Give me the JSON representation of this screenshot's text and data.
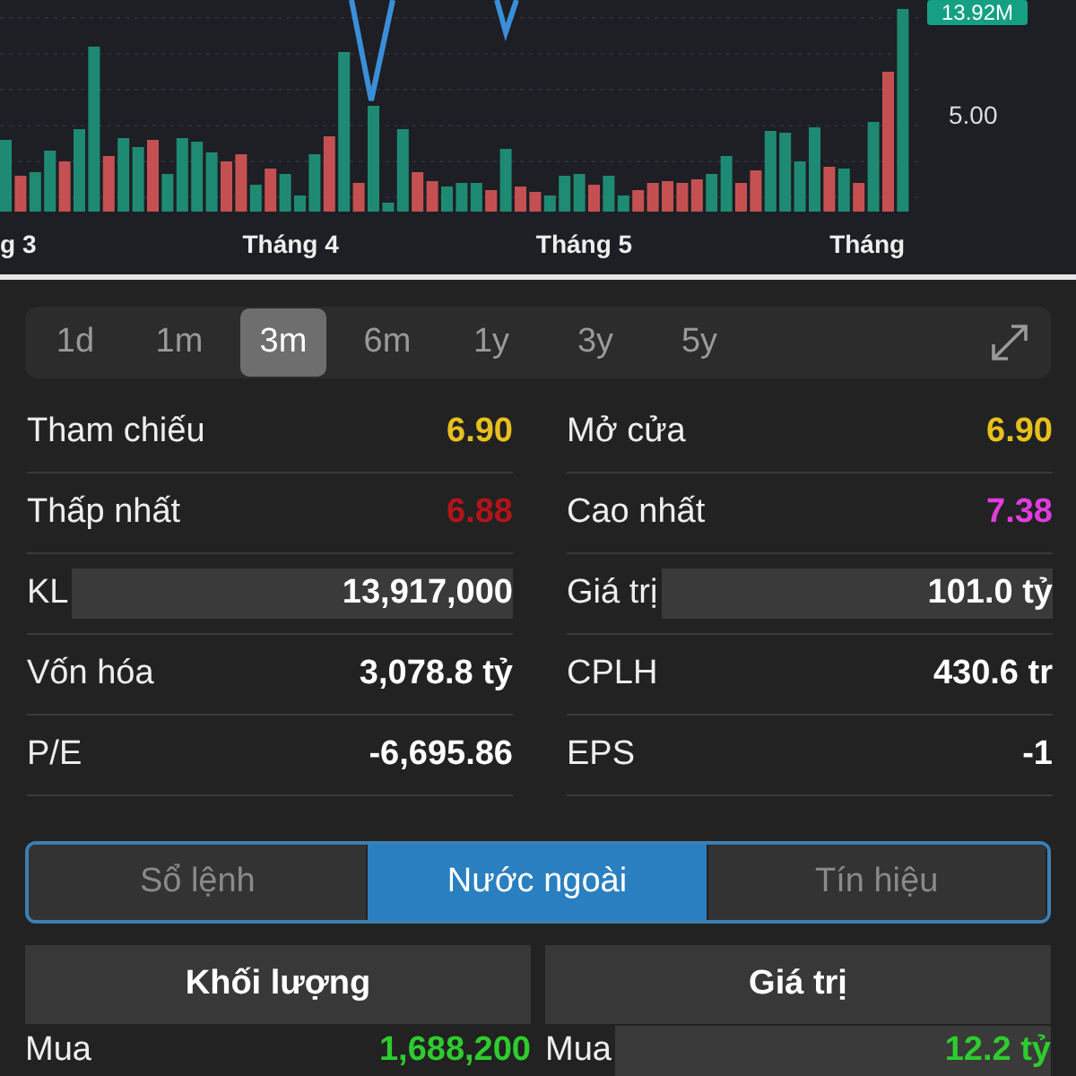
{
  "chart": {
    "price_badge": "13.92M",
    "axis_label": "5.00",
    "x_labels": [
      "g 3",
      "Tháng 4",
      "Tháng 5",
      "Tháng"
    ]
  },
  "periods": [
    {
      "label": "1d",
      "selected": false
    },
    {
      "label": "1m",
      "selected": false
    },
    {
      "label": "3m",
      "selected": true
    },
    {
      "label": "6m",
      "selected": false
    },
    {
      "label": "1y",
      "selected": false
    },
    {
      "label": "3y",
      "selected": false
    },
    {
      "label": "5y",
      "selected": false
    }
  ],
  "stats": [
    {
      "label": "Tham chiếu",
      "value": "6.90",
      "color": "#e8c01e",
      "highlighted": false
    },
    {
      "label": "Mở cửa",
      "value": "6.90",
      "color": "#e8c01e",
      "highlighted": false
    },
    {
      "label": "Thấp nhất",
      "value": "6.88",
      "color": "#b3141a",
      "highlighted": false
    },
    {
      "label": "Cao nhất",
      "value": "7.38",
      "color": "#e03ce0",
      "highlighted": false
    },
    {
      "label": "KL",
      "value": "13,917,000",
      "color": "#ffffff",
      "highlighted": true
    },
    {
      "label": "Giá trị",
      "value": "101.0 tỷ",
      "color": "#ffffff",
      "highlighted": true
    },
    {
      "label": "Vốn hóa",
      "value": "3,078.8 tỷ",
      "color": "#ffffff",
      "highlighted": false
    },
    {
      "label": "CPLH",
      "value": "430.6 tr",
      "color": "#ffffff",
      "highlighted": false
    },
    {
      "label": "P/E",
      "value": "-6,695.86",
      "color": "#ffffff",
      "highlighted": false
    },
    {
      "label": "EPS",
      "value": "-1",
      "color": "#ffffff",
      "highlighted": false
    }
  ],
  "tabs": [
    {
      "label": "Sổ lệnh",
      "selected": false
    },
    {
      "label": "Nước ngoài",
      "selected": true
    },
    {
      "label": "Tín hiệu",
      "selected": false
    }
  ],
  "columns": [
    "Khối lượng",
    "Giá trị"
  ],
  "rows": [
    {
      "label": "Mua",
      "value": "1,688,200",
      "color": "#2ecc2e",
      "highlighted": false
    },
    {
      "label": "Mua",
      "value": "12.2 tỷ",
      "color": "#2ecc2e",
      "highlighted": true
    }
  ]
}
